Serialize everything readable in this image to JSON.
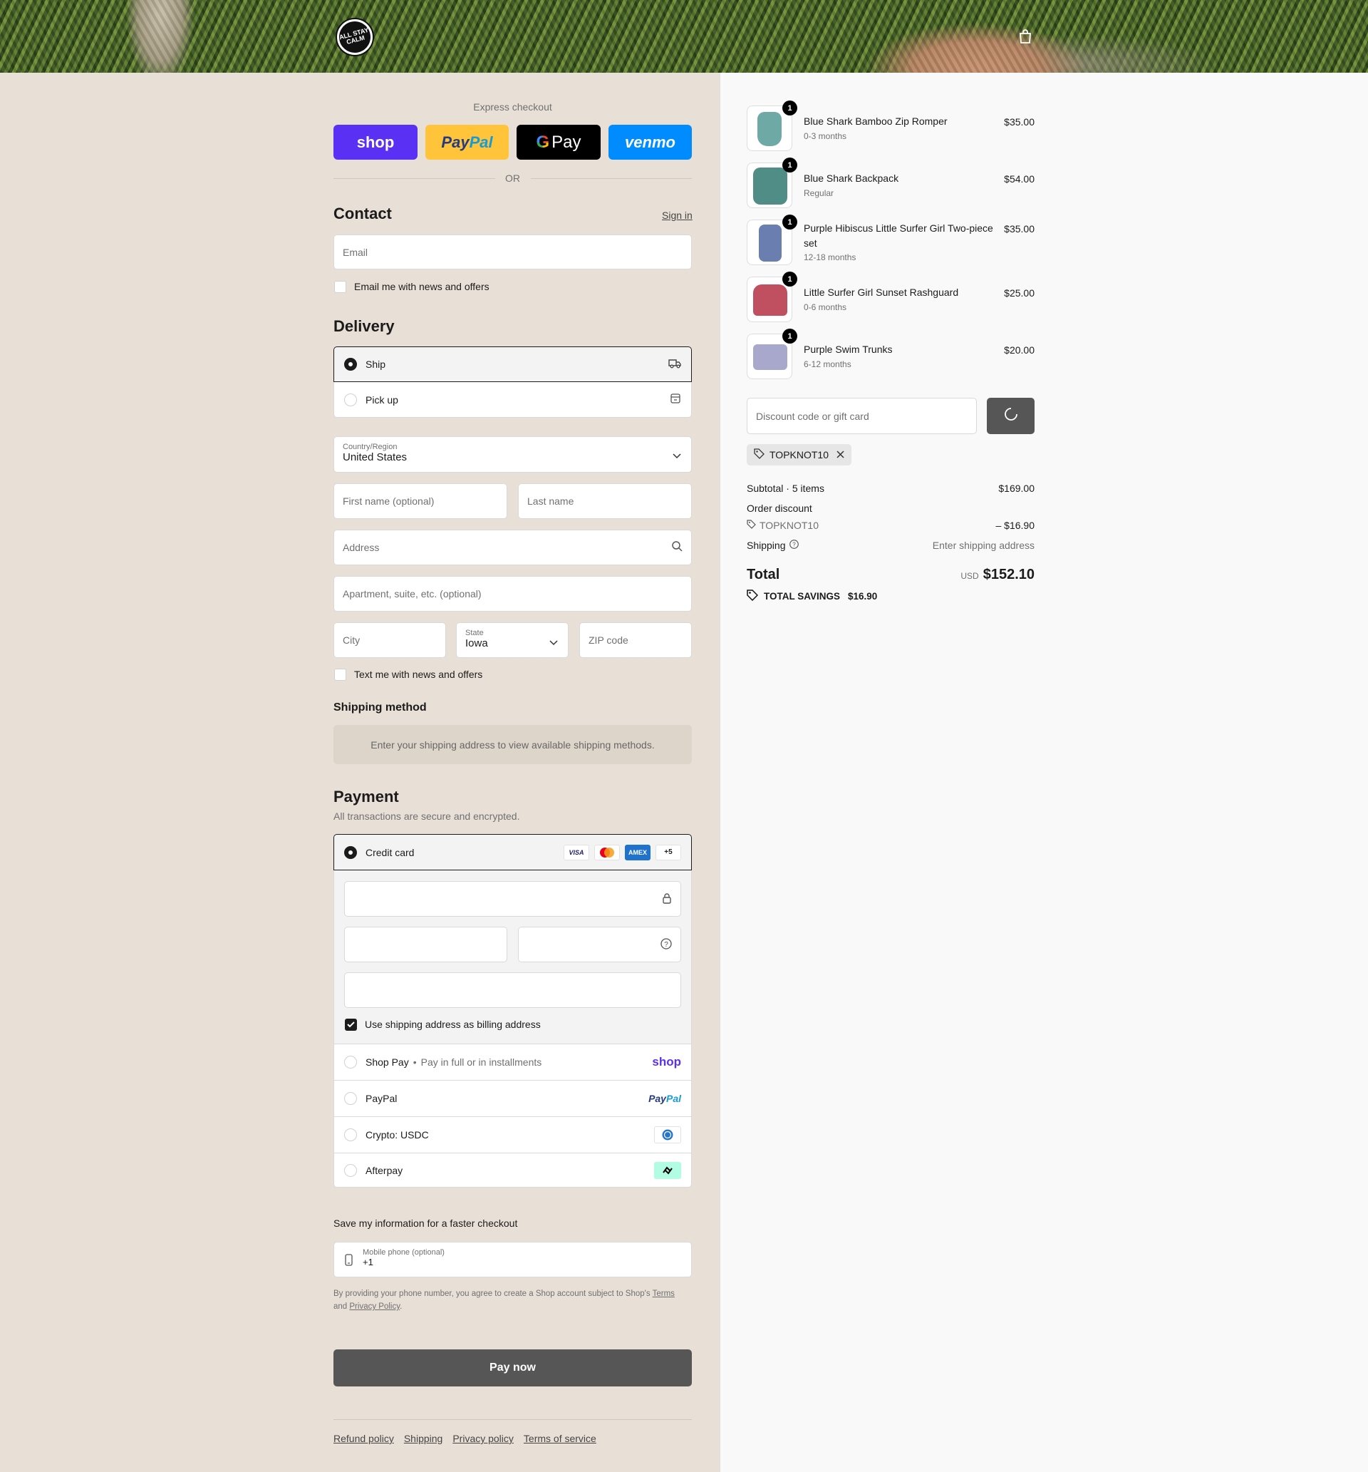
{
  "header": {
    "logo_text": "ALL STAY CALM",
    "bag_icon": "shopping-bag-icon"
  },
  "express": {
    "label": "Express checkout",
    "shop": "shop",
    "paypal_a": "Pay",
    "paypal_b": "Pal",
    "gpay": "Pay",
    "venmo": "venmo",
    "or": "OR"
  },
  "contact": {
    "title": "Contact",
    "sign_in": "Sign in",
    "email_placeholder": "Email",
    "news": "Email me with news and offers"
  },
  "delivery": {
    "title": "Delivery",
    "ship": "Ship",
    "pickup": "Pick up",
    "country_label": "Country/Region",
    "country_value": "United States",
    "first_name": "First name (optional)",
    "last_name": "Last name",
    "address": "Address",
    "apartment": "Apartment, suite, etc. (optional)",
    "city": "City",
    "state_label": "State",
    "state_value": "Iowa",
    "zip": "ZIP code",
    "text_news": "Text me with news and offers"
  },
  "shipping_method": {
    "title": "Shipping method",
    "notice": "Enter your shipping address to view available shipping methods."
  },
  "payment": {
    "title": "Payment",
    "subtitle": "All transactions are secure and encrypted.",
    "credit_card": "Credit card",
    "cards": [
      "VISA",
      "MC",
      "AMEX",
      "+5"
    ],
    "billing_same": "Use shipping address as billing address",
    "shop_pay": "Shop Pay",
    "shop_pay_sub": "Pay in full or in installments",
    "shop_pay_logo": "shop",
    "paypal": "PayPal",
    "paypal_logo_a": "Pay",
    "paypal_logo_b": "Pal",
    "crypto": "Crypto: USDC",
    "afterpay": "Afterpay"
  },
  "save_info": {
    "title": "Save my information for a faster checkout",
    "phone_label": "Mobile phone (optional)",
    "phone_value": "+1",
    "disclaimer_a": "By providing your phone number, you agree to create a Shop account subject to Shop's",
    "terms": "Terms",
    "and": "and",
    "privacy": "Privacy Policy",
    "period": "."
  },
  "pay_now": "Pay now",
  "footer": [
    "Refund policy",
    "Shipping",
    "Privacy policy",
    "Terms of service"
  ],
  "cart": {
    "items": [
      {
        "name": "Blue Shark Bamboo Zip Romper",
        "variant": "0-3 months",
        "price": "$35.00",
        "qty": "1",
        "color": "#6fa9a6"
      },
      {
        "name": "Blue Shark Backpack",
        "variant": "Regular",
        "price": "$54.00",
        "qty": "1",
        "color": "#4f8d86"
      },
      {
        "name": "Purple Hibiscus Little Surfer Girl Two-piece set",
        "variant": "12-18 months",
        "price": "$35.00",
        "qty": "1",
        "color": "#6a7fb0"
      },
      {
        "name": "Little Surfer Girl Sunset Rashguard",
        "variant": "0-6 months",
        "price": "$25.00",
        "qty": "1",
        "color": "#c0505f"
      },
      {
        "name": "Purple Swim Trunks",
        "variant": "6-12 months",
        "price": "$20.00",
        "qty": "1",
        "color": "#a8a7cc"
      }
    ],
    "discount_placeholder": "Discount code or gift card",
    "applied_code": "TOPKNOT10",
    "subtotal_label": "Subtotal · 5 items",
    "subtotal": "$169.00",
    "order_discount": "Order discount",
    "discount_code": "TOPKNOT10",
    "discount_amount": "– $16.90",
    "shipping_label": "Shipping",
    "shipping_value": "Enter shipping address",
    "total_label": "Total",
    "currency": "USD",
    "total": "$152.10",
    "savings_label": "TOTAL SAVINGS",
    "savings": "$16.90"
  },
  "colors": {
    "shop": "#5a31f4",
    "paypal": "#ffc439",
    "venmo": "#008cff",
    "pay_now": "#565656",
    "bg_left": "#e8e0d6",
    "bg_right": "#f9f9f9"
  }
}
